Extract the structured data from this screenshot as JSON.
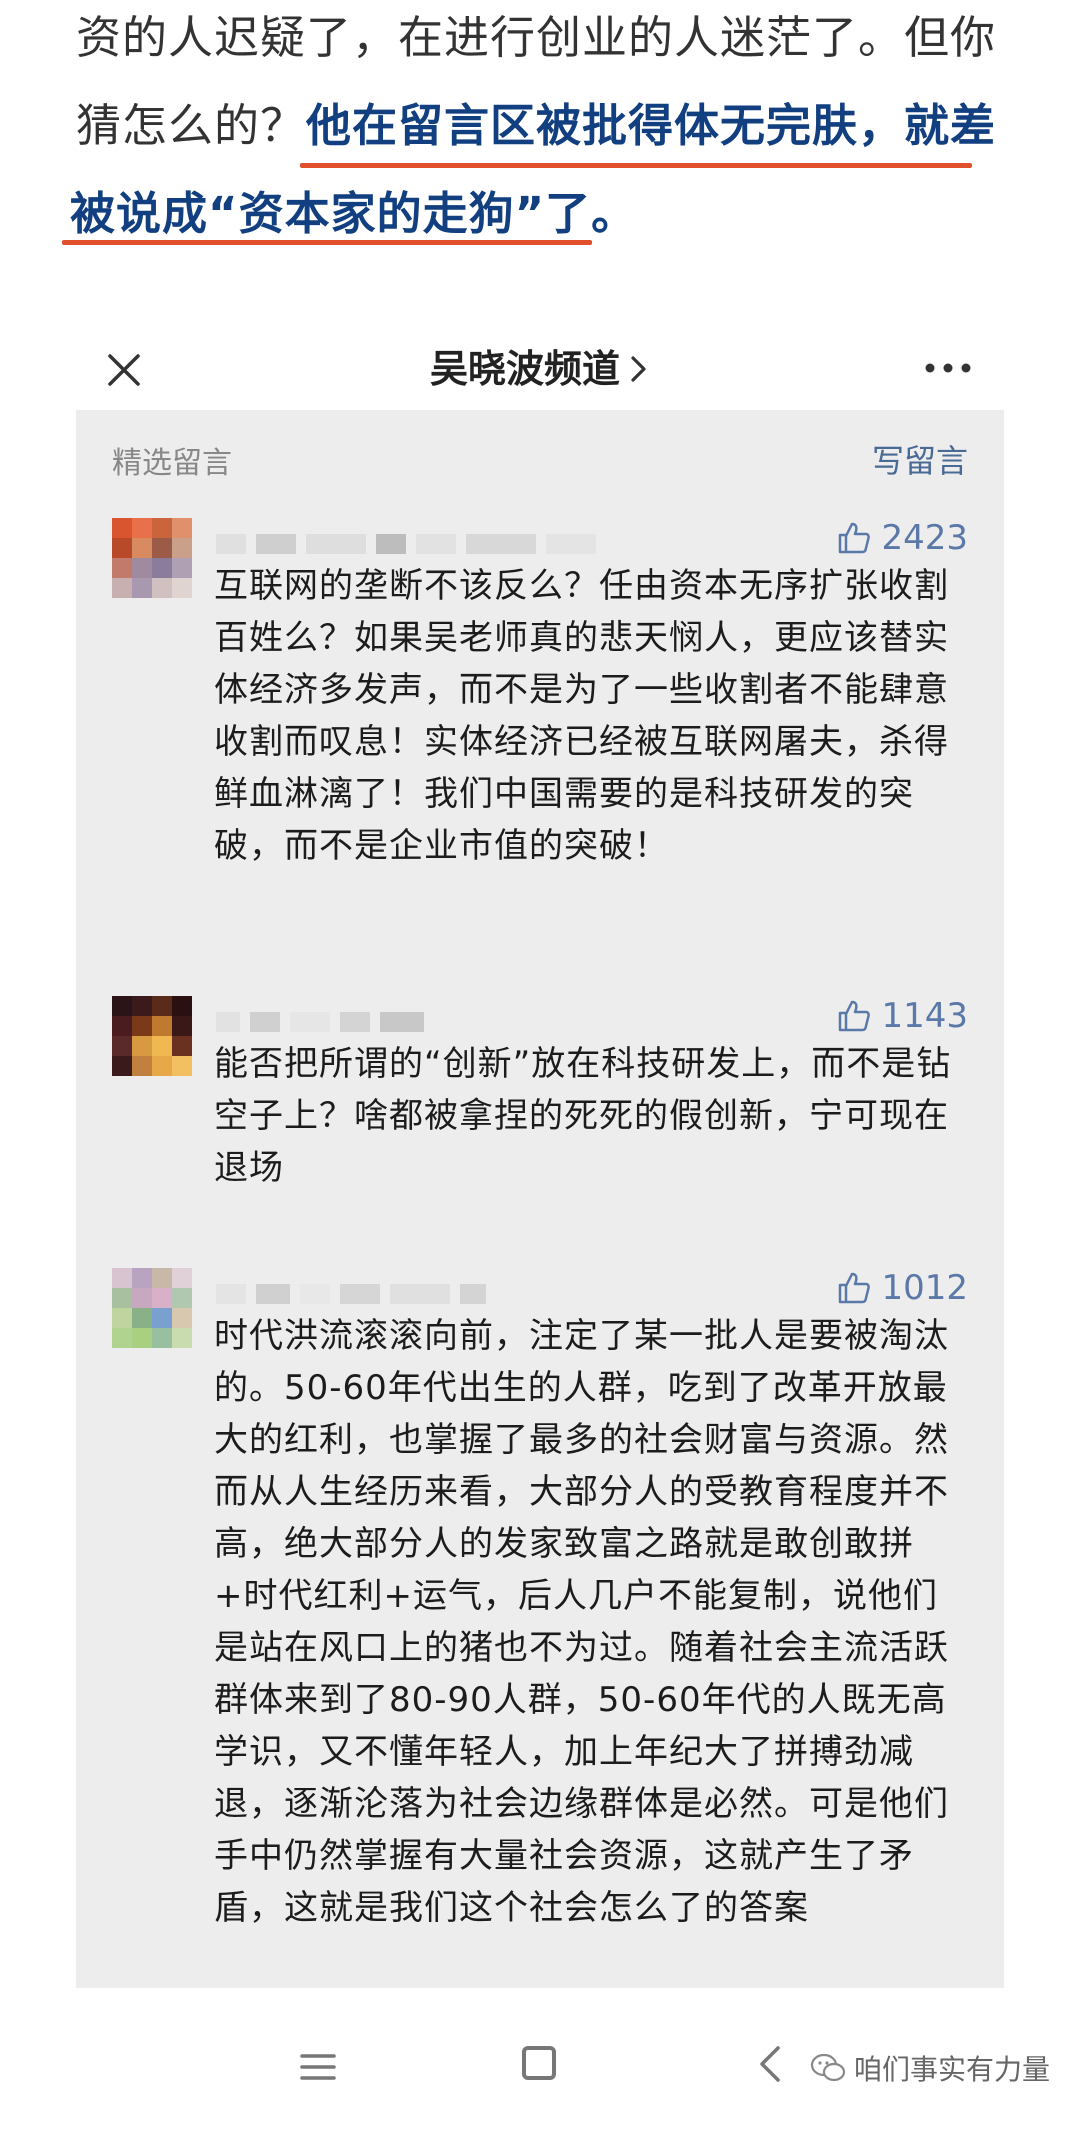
{
  "article": {
    "line1": "资的人迟疑了，在进行创业的人迷茫了。但你",
    "line2_plain": "猜怎么的？",
    "line2_highlight": "他在留言区被批得体无完肤，就差",
    "line3_highlight": "被说成“资本家的走狗”了。"
  },
  "screenshot": {
    "channel_title": "吴晓波频道",
    "section_title": "精选留言",
    "write_comment": "写留言",
    "comments": [
      {
        "likes": "2423",
        "text": "互联网的垄断不该反么？任由资本无序扩张收割百姓么？如果吴老师真的悲天悯人，更应该替实体经济多发声，而不是为了一些收割者不能肆意收割而叹息！实体经济已经被互联网屠夫，杀得鲜血淋漓了！我们中国需要的是科技研发的突破，而不是企业市值的突破！"
      },
      {
        "likes": "1143",
        "text": "能否把所谓的“创新”放在科技研发上，而不是钻空子上？啥都被拿捏的死死的假创新，宁可现在退场"
      },
      {
        "likes": "1012",
        "text": "时代洪流滚滚向前，注定了某一批人是要被淘汰的。50-60年代出生的人群，吃到了改革开放最大的红利，也掌握了最多的社会财富与资源。然而从人生经历来看，大部分人的受教育程度并不高，绝大部分人的发家致富之路就是敢创敢拼+时代红利+运气，后人几户不能复制，说他们是站在风口上的猪也不为过。随着社会主流活跃群体来到了80-90人群，50-60年代的人既无高学识，又不懂年轻人，加上年纪大了拼搏劲减退，逐渐沦落为社会边缘群体是必然。可是他们手中仍然掌握有大量社会资源，这就产生了矛盾，这就是我们这个社会怎么了的答案"
      }
    ]
  },
  "watermark": "咱们事实有力量",
  "colors": {
    "highlight": "#123f80",
    "underline": "#e0502d",
    "like": "#5a78a8",
    "card_bg": "#ededed"
  },
  "icons": [
    "close-icon",
    "chevron-right-icon",
    "more-icon",
    "thumbs-up-icon",
    "menu-icon",
    "home-icon",
    "back-icon",
    "wechat-icon"
  ]
}
